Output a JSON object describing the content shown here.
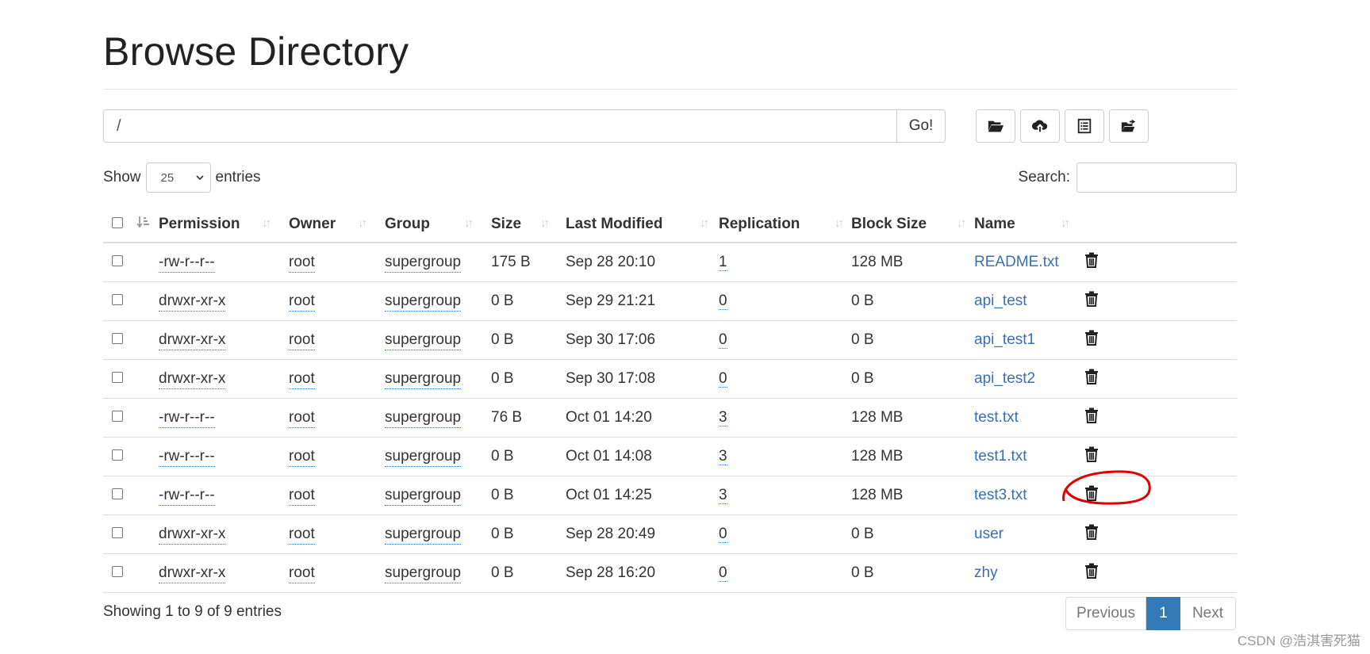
{
  "page": {
    "title": "Browse Directory"
  },
  "path_bar": {
    "value": "/",
    "go_label": "Go!"
  },
  "toolbar": {
    "icons": [
      "folder-open-icon",
      "cloud-upload-icon",
      "list-alt-icon",
      "folder-move-icon"
    ]
  },
  "entries": {
    "show_label": "Show",
    "select_value": "25",
    "entries_label": "entries"
  },
  "search": {
    "label": "Search:",
    "value": ""
  },
  "table": {
    "headers": [
      "Permission",
      "Owner",
      "Group",
      "Size",
      "Last Modified",
      "Replication",
      "Block Size",
      "Name"
    ],
    "rows": [
      {
        "permission": "-rw-r--r--",
        "owner": "root",
        "group": "supergroup",
        "size": "175 B",
        "modified": "Sep 28 20:10",
        "replication": "1",
        "block_size": "128 MB",
        "name": "README.txt"
      },
      {
        "permission": "drwxr-xr-x",
        "owner": "root",
        "group": "supergroup",
        "size": "0 B",
        "modified": "Sep 29 21:21",
        "replication": "0",
        "block_size": "0 B",
        "name": "api_test"
      },
      {
        "permission": "drwxr-xr-x",
        "owner": "root",
        "group": "supergroup",
        "size": "0 B",
        "modified": "Sep 30 17:06",
        "replication": "0",
        "block_size": "0 B",
        "name": "api_test1"
      },
      {
        "permission": "drwxr-xr-x",
        "owner": "root",
        "group": "supergroup",
        "size": "0 B",
        "modified": "Sep 30 17:08",
        "replication": "0",
        "block_size": "0 B",
        "name": "api_test2"
      },
      {
        "permission": "-rw-r--r--",
        "owner": "root",
        "group": "supergroup",
        "size": "76 B",
        "modified": "Oct 01 14:20",
        "replication": "3",
        "block_size": "128 MB",
        "name": "test.txt"
      },
      {
        "permission": "-rw-r--r--",
        "owner": "root",
        "group": "supergroup",
        "size": "0 B",
        "modified": "Oct 01 14:08",
        "replication": "3",
        "block_size": "128 MB",
        "name": "test1.txt"
      },
      {
        "permission": "-rw-r--r--",
        "owner": "root",
        "group": "supergroup",
        "size": "0 B",
        "modified": "Oct 01 14:25",
        "replication": "3",
        "block_size": "128 MB",
        "name": "test3.txt"
      },
      {
        "permission": "drwxr-xr-x",
        "owner": "root",
        "group": "supergroup",
        "size": "0 B",
        "modified": "Sep 28 20:49",
        "replication": "0",
        "block_size": "0 B",
        "name": "user"
      },
      {
        "permission": "drwxr-xr-x",
        "owner": "root",
        "group": "supergroup",
        "size": "0 B",
        "modified": "Sep 28 16:20",
        "replication": "0",
        "block_size": "0 B",
        "name": "zhy"
      }
    ]
  },
  "footer": {
    "info": "Showing 1 to 9 of 9 entries"
  },
  "pagination": {
    "previous": "Previous",
    "current": "1",
    "next": "Next"
  },
  "watermark": "CSDN @浩淇害死猫",
  "colors": {
    "link": "#3a6eb3",
    "active_page": "#337ab7",
    "annotation": "#e00000"
  }
}
